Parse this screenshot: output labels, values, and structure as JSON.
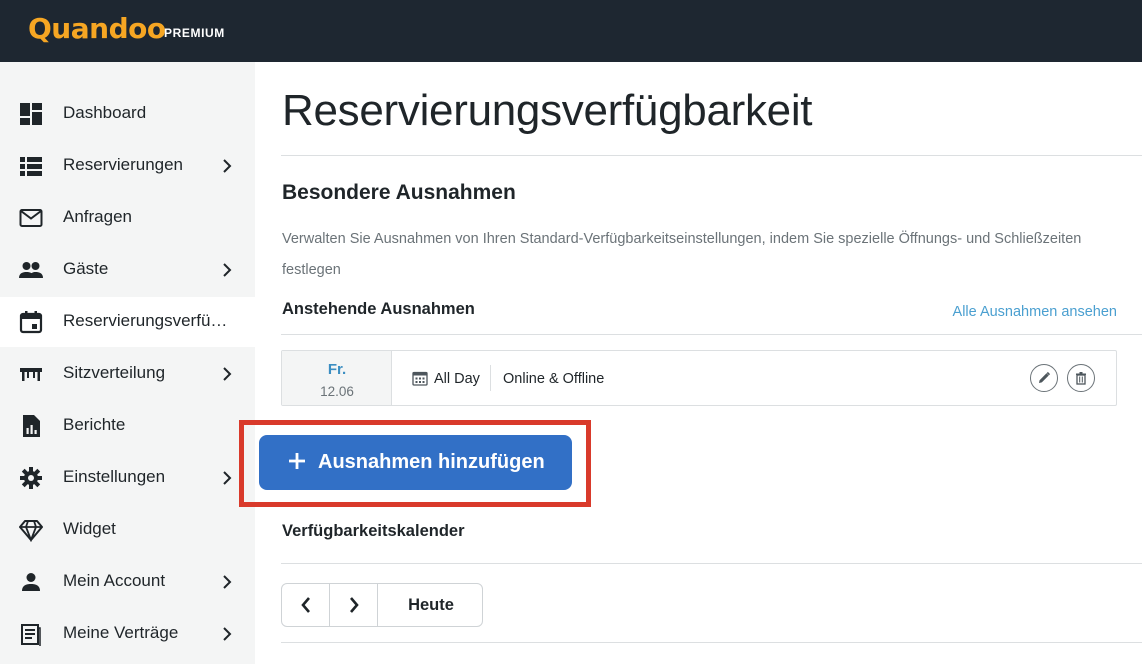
{
  "brand": {
    "logo": "Quandoo",
    "tier": "PREMIUM",
    "accent_color": "#f6a623",
    "topbar_color": "#1e2731"
  },
  "sidebar": {
    "items": [
      {
        "label": "Dashboard",
        "icon": "dashboard-icon",
        "has_chevron": false
      },
      {
        "label": "Reservierungen",
        "icon": "list-icon",
        "has_chevron": true
      },
      {
        "label": "Anfragen",
        "icon": "mail-icon",
        "has_chevron": false
      },
      {
        "label": "Gäste",
        "icon": "people-icon",
        "has_chevron": true
      },
      {
        "label": "Reservierungsverfügbarkeit",
        "icon": "calendar-icon",
        "has_chevron": false,
        "active": true
      },
      {
        "label": "Sitzverteilung",
        "icon": "table-icon",
        "has_chevron": true
      },
      {
        "label": "Berichte",
        "icon": "report-icon",
        "has_chevron": false
      },
      {
        "label": "Einstellungen",
        "icon": "gear-icon",
        "has_chevron": true
      },
      {
        "label": "Widget",
        "icon": "diamond-icon",
        "has_chevron": false
      },
      {
        "label": "Mein Account",
        "icon": "person-icon",
        "has_chevron": true
      },
      {
        "label": "Meine Verträge",
        "icon": "contract-icon",
        "has_chevron": true
      }
    ]
  },
  "main": {
    "title": "Reservierungsverfügbarkeit",
    "section_title": "Besondere Ausnahmen",
    "section_desc": "Verwalten Sie Ausnahmen von Ihren Standard-Verfügbarkeitseinstellungen, indem Sie spezielle Öffnungs- und Schließzeiten festlegen",
    "upcoming_title": "Anstehende Ausnahmen",
    "view_all_link": "Alle Ausnahmen ansehen",
    "exceptions": [
      {
        "day": "Fr.",
        "date": "12.06",
        "time": "All Day",
        "channel": "Online & Offline"
      }
    ],
    "add_button": "Ausnahmen hinzufügen",
    "calendar_title": "Verfügbarkeitskalender",
    "today_button": "Heute"
  },
  "colors": {
    "primary_button": "#3270c6",
    "highlight_border": "#d93a2b",
    "link": "#4a9fd0"
  }
}
